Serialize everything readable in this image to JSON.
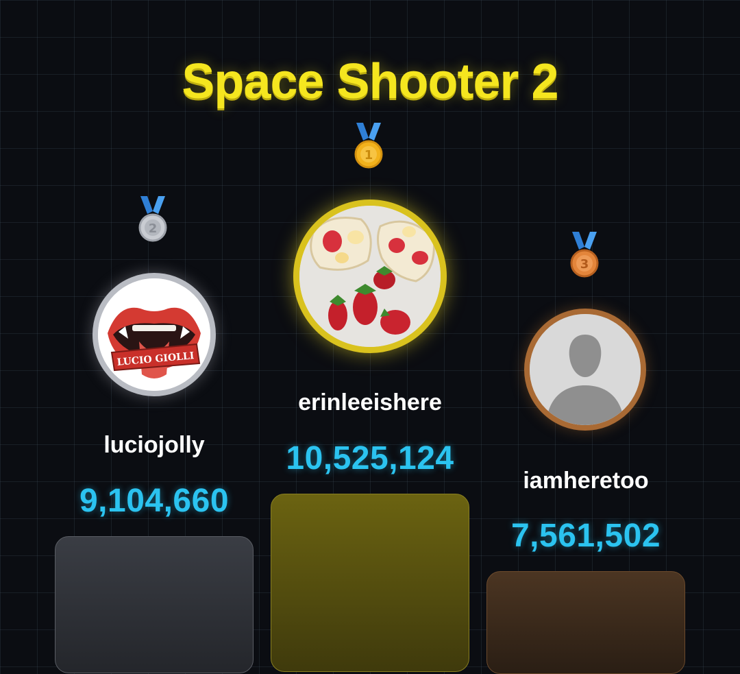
{
  "game": {
    "title": "Space Shooter 2"
  },
  "podium": [
    {
      "rank": 2,
      "medal_icon": "silver-medal-icon",
      "username": "luciojolly",
      "score": "9,104,660",
      "avatar_logo_text": "LUCIO GIOLLI",
      "color": "#b9bcc3"
    },
    {
      "rank": 1,
      "medal_icon": "gold-medal-icon",
      "username": "erinleeishere",
      "score": "10,525,124",
      "avatar_logo_text": "",
      "color": "#d9c21e"
    },
    {
      "rank": 3,
      "medal_icon": "bronze-medal-icon",
      "username": "iamheretoo",
      "score": "7,561,502",
      "avatar_logo_text": "",
      "color": "#a96a34"
    }
  ],
  "colors": {
    "score": "#2bc3f0",
    "title": "#f5e61f",
    "background": "#0b0d12"
  }
}
